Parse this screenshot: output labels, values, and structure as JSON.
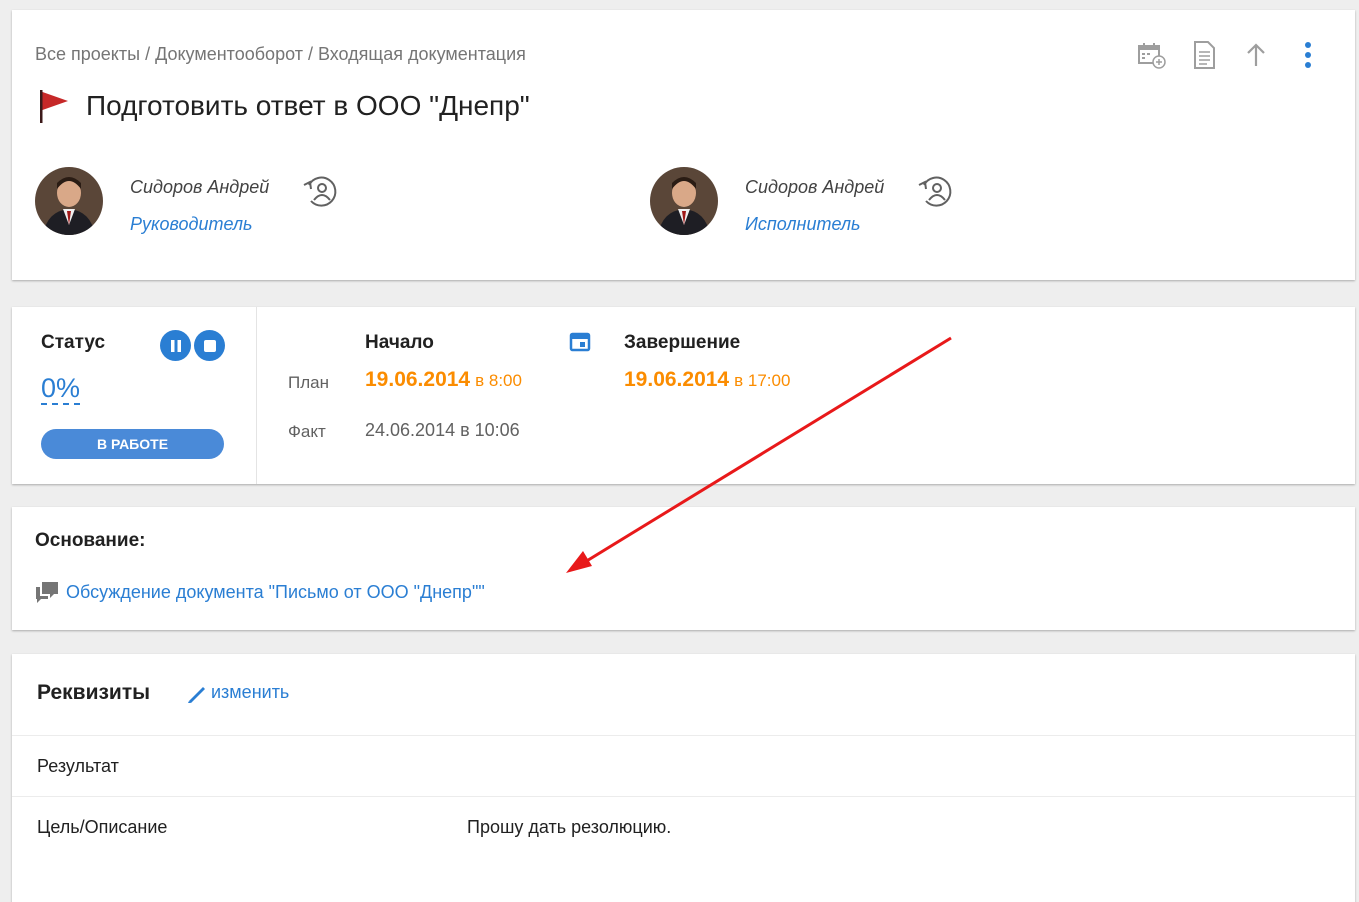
{
  "breadcrumb": {
    "item1": "Все проекты",
    "sep1": " / ",
    "item2": "Документооборот",
    "sep2": " / ",
    "item3": "Входящая документация"
  },
  "task": {
    "title": "Подготовить ответ в ООО \"Днепр\""
  },
  "toolbar": {
    "icons": [
      "calendar-add-icon",
      "document-icon",
      "arrow-up-icon",
      "more-vert-icon"
    ]
  },
  "people": [
    {
      "name": "Сидоров Андрей",
      "role": "Руководитель"
    },
    {
      "name": "Сидоров Андрей",
      "role": "Исполнитель"
    }
  ],
  "status": {
    "label": "Статус",
    "percent": "0%",
    "state_button": "В РАБОТЕ"
  },
  "dates": {
    "start_header": "Начало",
    "end_header": "Завершение",
    "plan_label": "План",
    "fact_label": "Факт",
    "plan_start_date": "19.06.2014",
    "plan_start_time": "в 8:00",
    "plan_end_date": "19.06.2014",
    "plan_end_time": "в 17:00",
    "fact_start": "24.06.2014 в 10:06"
  },
  "basis": {
    "label": "Основание:",
    "link": "Обсуждение документа \"Письмо от ООО \"Днепр\"\""
  },
  "requisites": {
    "title": "Реквизиты",
    "edit_label": "изменить",
    "rows": [
      {
        "key": "Результат",
        "value": ""
      },
      {
        "key": "Цель/Описание",
        "value": "Прошу дать резолюцию."
      }
    ]
  },
  "colors": {
    "accent": "#2a7ed3",
    "date_highlight": "#fb8c00",
    "annotation_arrow": "#e8191a"
  }
}
